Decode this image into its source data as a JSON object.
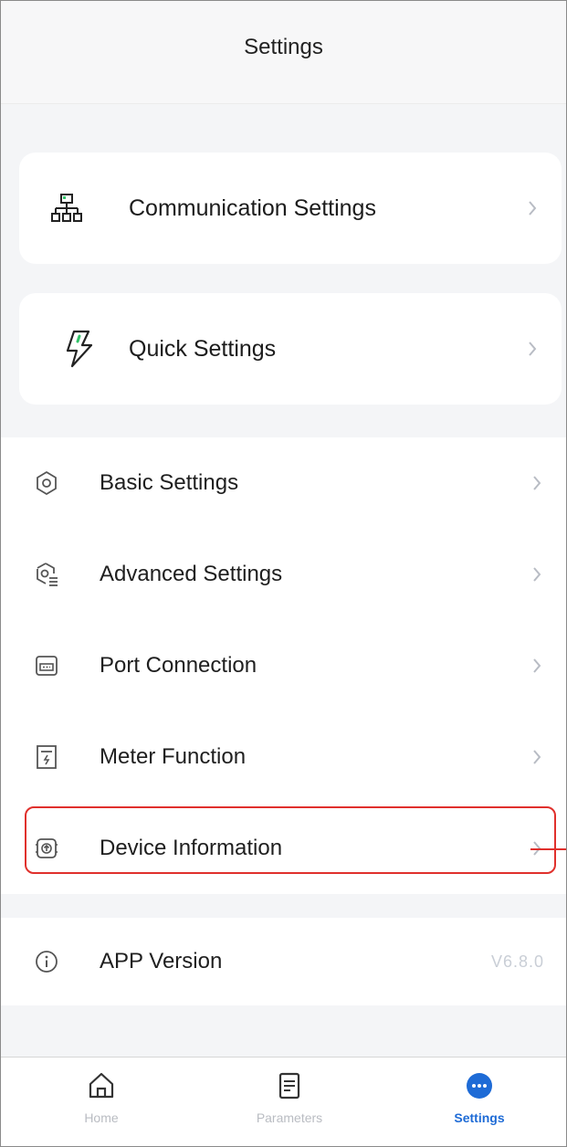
{
  "header": {
    "title": "Settings"
  },
  "cards": [
    {
      "label": "Communication Settings",
      "icon": "network-icon"
    },
    {
      "label": "Quick Settings",
      "icon": "lightning-icon"
    }
  ],
  "menu": [
    {
      "label": "Basic Settings",
      "icon": "gear-icon"
    },
    {
      "label": "Advanced Settings",
      "icon": "gear-list-icon"
    },
    {
      "label": "Port Connection",
      "icon": "port-icon"
    },
    {
      "label": "Meter Function",
      "icon": "meter-icon"
    },
    {
      "label": "Device Information",
      "icon": "device-chip-icon"
    }
  ],
  "app_version": {
    "label": "APP Version",
    "value": "V6.8.0",
    "icon": "info-icon"
  },
  "tabbar": {
    "tabs": [
      {
        "label": "Home",
        "icon": "home-icon"
      },
      {
        "label": "Parameters",
        "icon": "document-icon"
      },
      {
        "label": "Settings",
        "icon": "more-dots-icon"
      }
    ],
    "active": "Settings"
  },
  "colors": {
    "accent": "#1e6bd6",
    "highlight": "#e0302c",
    "background": "#f4f5f7"
  }
}
